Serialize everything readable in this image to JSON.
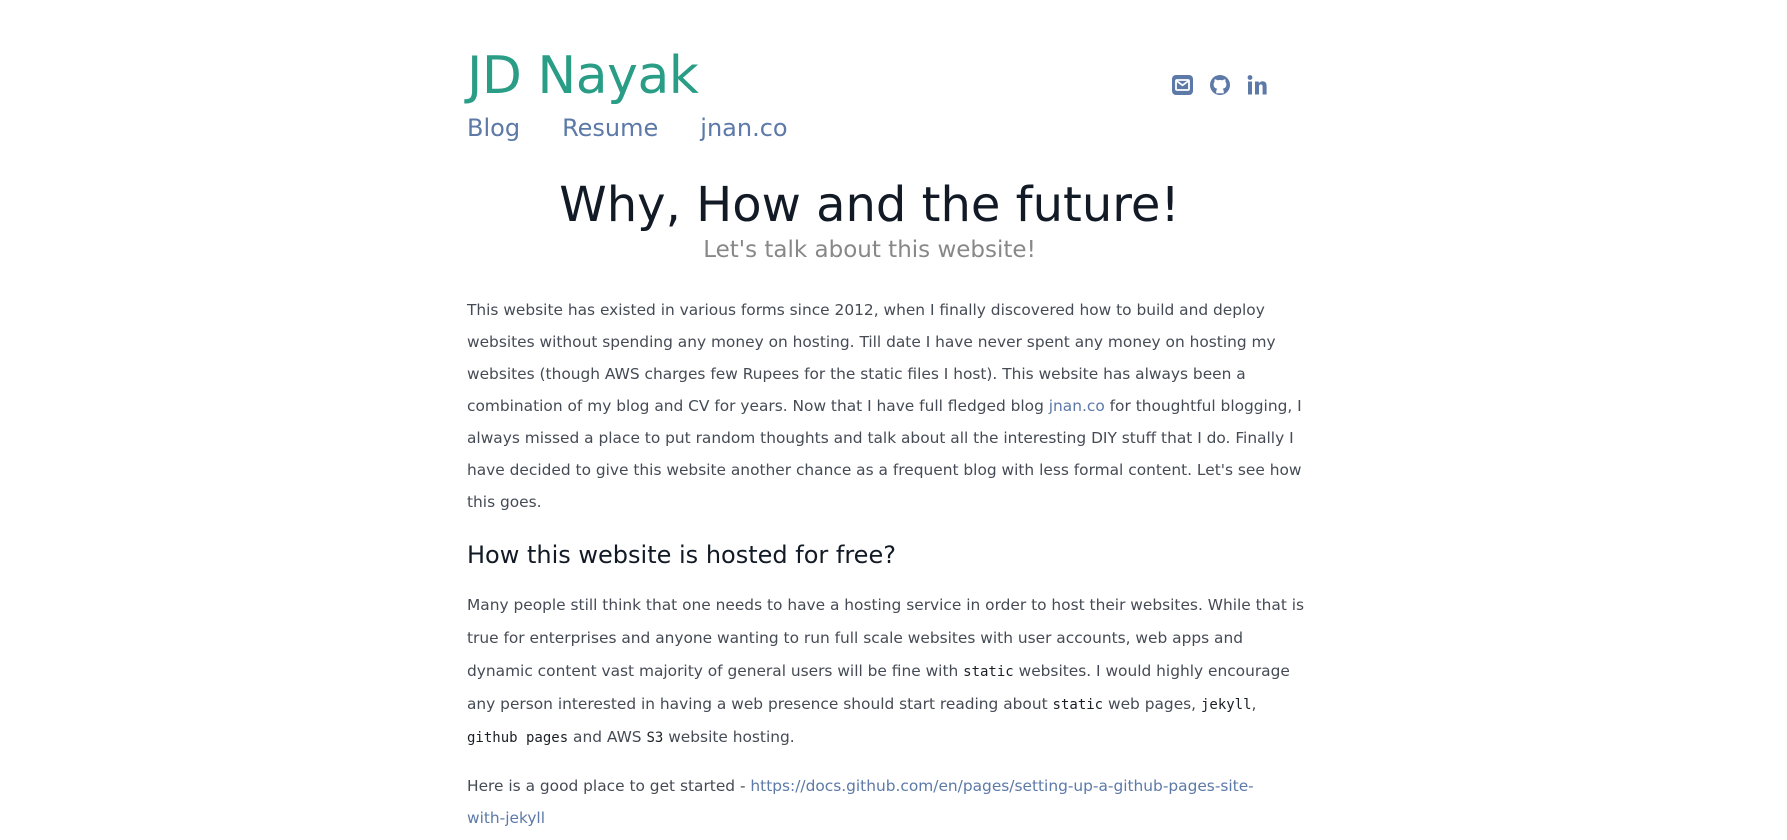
{
  "header": {
    "site_title": "JD Nayak",
    "nav": [
      "Blog",
      "Resume",
      "jnan.co"
    ],
    "social_icons": [
      "email-icon",
      "github-icon",
      "linkedin-icon"
    ]
  },
  "post": {
    "title": "Why, How and the future!",
    "subtitle": "Let's talk about this website!",
    "p1": {
      "l1": "This website has existed in various forms since 2012, when I finally discovered how to build and deploy",
      "l2": "websites without spending any money on hosting. Till date I have never spent any money on hosting my",
      "l3": "websites (though AWS charges few Rupees for the static files I host). This website has always been a",
      "l4_a": "combination of my blog and CV for years. Now that I have full fledged blog ",
      "l4_link": "jnan.co",
      "l4_b": " for thoughtful blogging, I",
      "l5": "always missed a place to put random thoughts and talk about all the interesting DIY stuff that I do. Finally I",
      "l6": "have decided to give this website another chance as a frequent blog with less formal content. Let's see how",
      "l7": "this goes."
    },
    "h2": "How this website is hosted for free?",
    "p2": {
      "l1": "Many people still think that one needs to have a hosting service in order to host their websites. While that is",
      "l2": "true for enterprises and anyone wanting to run full scale websites with user accounts, web apps and",
      "l3_a": "dynamic content vast majority of general users will be fine with ",
      "l3_code": "static",
      "l3_b": " websites. I would highly encourage",
      "l4_a": "any person interested in having a web presence should start reading about ",
      "l4_code1": "static",
      "l4_b": " web pages, ",
      "l4_code2": "jekyll",
      "l4_c": ",",
      "l5_code1": "github pages",
      "l5_a": " and AWS ",
      "l5_code2": "S3",
      "l5_b": " website hosting."
    },
    "p3": {
      "lead": "Here is a good place to get started - ",
      "link_l1": "https://docs.github.com/en/pages/setting-up-a-github-pages-site-",
      "link_l2": "with-jekyll"
    }
  },
  "colors": {
    "accent": "#2a9d86",
    "link": "#5c79a8",
    "heading": "#121a26",
    "text": "#454b55",
    "muted": "#888888"
  }
}
